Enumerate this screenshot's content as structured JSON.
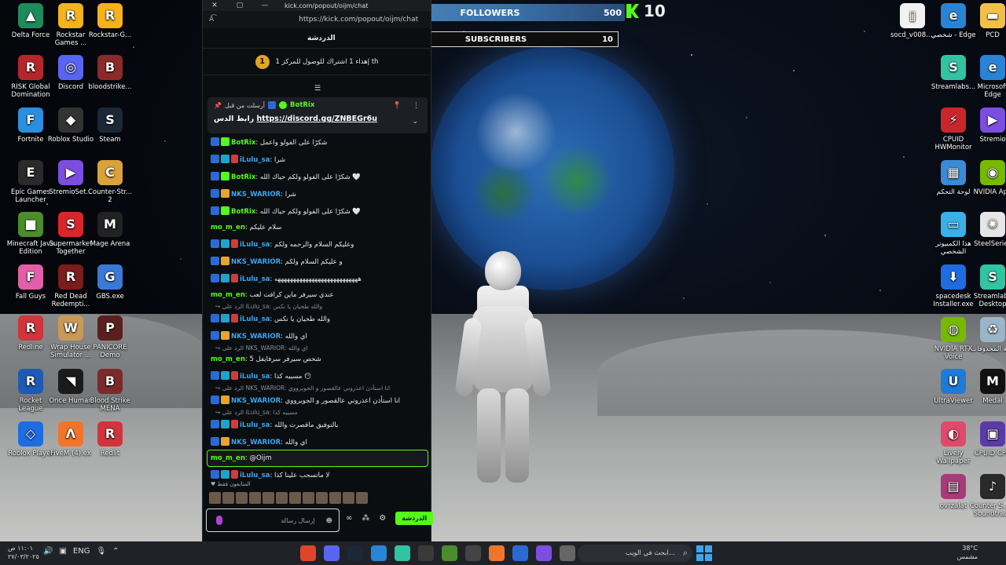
{
  "desktop_left": [
    {
      "label": "Delta Force",
      "color": "#1f8a5b",
      "glyph": "▲"
    },
    {
      "label": "Rockstar Games ...",
      "color": "#f5b21b",
      "glyph": "R"
    },
    {
      "label": "Rockstar-G...",
      "color": "#f5b21b",
      "glyph": "R"
    },
    {
      "label": "RISK Global Domination",
      "color": "#b3262b",
      "glyph": "R"
    },
    {
      "label": "Discord",
      "color": "#5865f2",
      "glyph": "◎"
    },
    {
      "label": "bloodstrike...",
      "color": "#8a2a2a",
      "glyph": "B"
    },
    {
      "label": "Fortnite",
      "color": "#2b8fe0",
      "glyph": "F"
    },
    {
      "label": "Roblox Studio",
      "color": "#333333",
      "glyph": "◆"
    },
    {
      "label": "Steam",
      "color": "#1b2838",
      "glyph": "S"
    },
    {
      "label": "Epic Games Launcher",
      "color": "#2a2a2a",
      "glyph": "E"
    },
    {
      "label": "StremioSet...",
      "color": "#7b4ee0",
      "glyph": "▶"
    },
    {
      "label": "Counter-Str... 2",
      "color": "#d9a23a",
      "glyph": "C"
    },
    {
      "label": "Minecraft Java Edition",
      "color": "#4c8c2b",
      "glyph": "■"
    },
    {
      "label": "Supermarket Together",
      "color": "#d8262b",
      "glyph": "S"
    },
    {
      "label": "Mage Arena",
      "color": "#222222",
      "glyph": "M"
    },
    {
      "label": "Fall Guys",
      "color": "#e15fa8",
      "glyph": "F"
    },
    {
      "label": "Red Dead Redempti...",
      "color": "#7a1d1d",
      "glyph": "R"
    },
    {
      "label": "GBS.exe",
      "color": "#3a7ad6",
      "glyph": "G"
    },
    {
      "label": "Redline",
      "color": "#d0343c",
      "glyph": "R"
    },
    {
      "label": "Wrap House Simulator ...",
      "color": "#c99a56",
      "glyph": "W"
    },
    {
      "label": "PANICORE Demo",
      "color": "#5a2020",
      "glyph": "P"
    },
    {
      "label": "Rocket League",
      "color": "#1e5ab5",
      "glyph": "R"
    },
    {
      "label": "Once Human",
      "color": "#1b1b1b",
      "glyph": "◥"
    },
    {
      "label": "Blood Strike MENA",
      "color": "#7a2a2a",
      "glyph": "B"
    },
    {
      "label": "Roblox Player",
      "color": "#1e6ce0",
      "glyph": "◇"
    },
    {
      "label": "FiveM (4).ex",
      "color": "#f0752a",
      "glyph": "Λ"
    },
    {
      "label": "Redlit",
      "color": "#d0343c",
      "glyph": "R"
    }
  ],
  "desktop_right": [
    {
      "label": "socd_v008....",
      "color": "#f2f2f2",
      "glyph": "▯"
    },
    {
      "label": "شخصي - Edge",
      "color": "#2a84d6",
      "glyph": "e"
    },
    {
      "label": "PCD",
      "color": "#f2c04a",
      "glyph": "▬"
    },
    {
      "label": "Streamlabs...",
      "color": "#31c3a2",
      "glyph": "S"
    },
    {
      "label": "Microsoft Edge",
      "color": "#2a84d6",
      "glyph": "e"
    },
    {
      "label": "CPUID HWMonitor",
      "color": "#c8262b",
      "glyph": "⚡"
    },
    {
      "label": "Stremio",
      "color": "#7b4ee0",
      "glyph": "▶"
    },
    {
      "label": "لوحة التحكم",
      "color": "#3a8ad6",
      "glyph": "▦"
    },
    {
      "label": "NVIDIA App",
      "color": "#76b900",
      "glyph": "◉"
    },
    {
      "label": "هذا الكمبيوتر الشخصي",
      "color": "#3ab0e8",
      "glyph": "▭"
    },
    {
      "label": "SteelSeries",
      "color": "#e6e6e6",
      "glyph": "✺"
    },
    {
      "label": "spacedesk Installer.exe",
      "color": "#1e6ce0",
      "glyph": "⬇"
    },
    {
      "label": "Streamlabs Desktop",
      "color": "#31c3a2",
      "glyph": "S"
    },
    {
      "label": "NVIDIA RTX Voice",
      "color": "#76b900",
      "glyph": "◍"
    },
    {
      "label": "سلة المحذوفات",
      "color": "#9ab4c8",
      "glyph": "♻"
    },
    {
      "label": "UltraViewer",
      "color": "#1e7ad6",
      "glyph": "U"
    },
    {
      "label": "Medal",
      "color": "#111111",
      "glyph": "M"
    },
    {
      "label": "Lively Wallpaper",
      "color": "#e04a6a",
      "glyph": "◐"
    },
    {
      "label": "CPUID CPU",
      "color": "#5a3aa6",
      "glyph": "▣"
    },
    {
      "label": "ovrzalat",
      "color": "#a83a7a",
      "glyph": "▤"
    },
    {
      "label": "Counter S... 2 Soundtrack",
      "color": "#2a2a2a",
      "glyph": "♪"
    }
  ],
  "window": {
    "title": "kick.com/popout/oijm/chat",
    "url": "https://kick.com/popout/oijm/chat",
    "header": "الدردشة",
    "goal": "إهداء 1 اشتراك للوصول للمركز 1 th",
    "goal_badge": "1"
  },
  "pinned": {
    "author": "BotRix",
    "prefix": "أرسلت من قبل",
    "text_prefix": "رابط الدس",
    "link": "https://discord.gg/ZNBEGr6u"
  },
  "messages": [
    {
      "user": "BotRix",
      "color": "#53fc18",
      "badges": [
        "kick",
        "verif"
      ],
      "text": "شكرًا على الفولو واعمل"
    },
    {
      "user": "iLulu_sa",
      "color": "#3aa6f0",
      "badges": [
        "kick",
        "sub",
        "red"
      ],
      "text": "شرا"
    },
    {
      "user": "BotRix",
      "color": "#53fc18",
      "badges": [
        "kick",
        "verif"
      ],
      "text": "شكرًا على الفولو ولكم حياك الله 🤍"
    },
    {
      "user": "NKS_WARIOR",
      "color": "#3aa6f0",
      "badges": [
        "kick",
        "crown"
      ],
      "text": "شرا"
    },
    {
      "user": "BotRix",
      "color": "#53fc18",
      "badges": [
        "kick",
        "verif"
      ],
      "text": "شكرًا على الفولو ولكم حياك الله 🤍"
    },
    {
      "user": "mo_m_en",
      "color": "#53fc18",
      "badges": [],
      "text": "سلام عليكم"
    },
    {
      "user": "iLulu_sa",
      "color": "#3aa6f0",
      "badges": [
        "kick",
        "sub",
        "red"
      ],
      "text": "وعليكم السلام والرحمه ولكم"
    },
    {
      "user": "NKS_WARIOR",
      "color": "#3aa6f0",
      "badges": [
        "kick",
        "crown"
      ],
      "text": "و عليكم السلام ولكم"
    },
    {
      "user": "iLulu_sa",
      "color": "#3aa6f0",
      "badges": [
        "kick",
        "sub",
        "red"
      ],
      "text": "هههههههههههههههههههههههههههه"
    },
    {
      "user": "mo_m_en",
      "color": "#53fc18",
      "badges": [],
      "text": "عندي سيرفر ماين كرافت لعب"
    },
    {
      "user": "iLulu_sa",
      "color": "#3aa6f0",
      "badges": [
        "kick",
        "sub",
        "red"
      ],
      "text": "والله طحيان يا نكس",
      "reply": "الرد على iLulu_sa: والله طحيان يا نكس"
    },
    {
      "user": "NKS_WARIOR",
      "color": "#3aa6f0",
      "badges": [
        "kick",
        "crown"
      ],
      "text": "اي والله"
    },
    {
      "user": "mo_m_en",
      "color": "#53fc18",
      "badges": [],
      "text": "شخص سيرفر سرفايفل 5",
      "reply": "الرد على NKS_WARIOR: اي والله"
    },
    {
      "user": "iLulu_sa",
      "color": "#3aa6f0",
      "badges": [
        "kick",
        "sub",
        "red"
      ],
      "text": "مسيبه كذا 😶"
    },
    {
      "user": "NKS_WARIOR",
      "color": "#3aa6f0",
      "badges": [
        "kick",
        "crown"
      ],
      "text": "انا استأذن اعذروني عالقصور و الجويرووي",
      "reply": "الرد على NKS_WARIOR: انا استأذن اعذروني عالقصور و الجويرووي"
    },
    {
      "user": "iLulu_sa",
      "color": "#3aa6f0",
      "badges": [
        "kick",
        "sub",
        "red"
      ],
      "text": "بالتوفيق ماقصرت والله",
      "reply": "الرد على iLulu_sa: مسيبه كذا"
    },
    {
      "user": "NKS_WARIOR",
      "color": "#3aa6f0",
      "badges": [
        "kick",
        "crown"
      ],
      "text": "اي والله"
    },
    {
      "user": "mo_m_en",
      "color": "#53fc18",
      "badges": [],
      "text": "@Oijm",
      "highlight": true
    },
    {
      "user": "iLulu_sa",
      "color": "#3aa6f0",
      "badges": [
        "kick",
        "sub",
        "red"
      ],
      "text": "لا ماتسحب علينا كذا"
    }
  ],
  "chat_footer": {
    "filter_label": "المتابعون فقط",
    "input_placeholder": "إرسال رسالة",
    "send_label": "الدردشة"
  },
  "overlay": {
    "followers_current": "293",
    "followers_label": "FOLLOWERS",
    "followers_goal": "500",
    "kick_count": "10",
    "subs_current": "0",
    "subs_label": "SUBSCRIBERS",
    "subs_goal": "10"
  },
  "taskbar": {
    "time": "١١:٠١ ص",
    "date": "٢٧/٠٣/٢٠٢٥",
    "lang": "ENG",
    "search_placeholder": "ابحث في الويب...",
    "weather_temp": "38°C",
    "weather_desc": "مشمس"
  }
}
